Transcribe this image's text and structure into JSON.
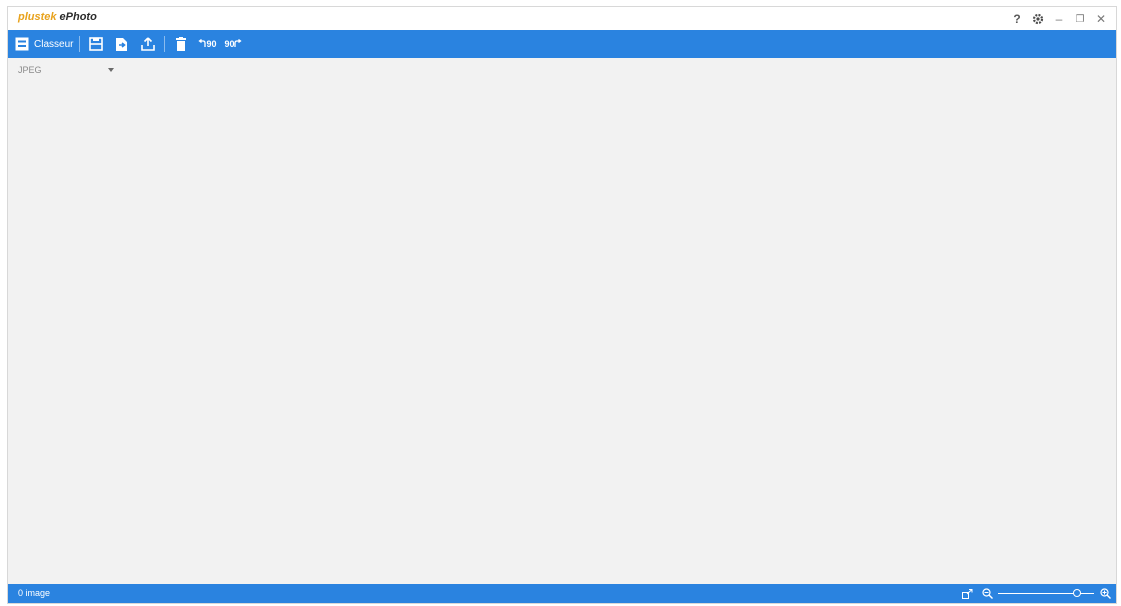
{
  "app": {
    "logo_brand": "plustek",
    "logo_product": "ePhoto"
  },
  "window_controls": {
    "help": "?",
    "minimize": "–",
    "restore": "❐",
    "close": "✕"
  },
  "toolbar": {
    "classeur_label": "Classeur",
    "rotate_left_label": "90",
    "rotate_right_label": "90",
    "icons": [
      "classeur-icon",
      "save-icon",
      "send-to-app-icon",
      "upload-icon",
      "delete-icon",
      "rotate-left-icon",
      "rotate-right-icon"
    ]
  },
  "format_select": {
    "value": "JPEG"
  },
  "status": {
    "image_count": "0 image"
  },
  "zoom": {
    "level": 0.82
  },
  "colors": {
    "accent": "#2a83e0",
    "background": "#f2f2f2",
    "logo_brand": "#e8a21c"
  }
}
